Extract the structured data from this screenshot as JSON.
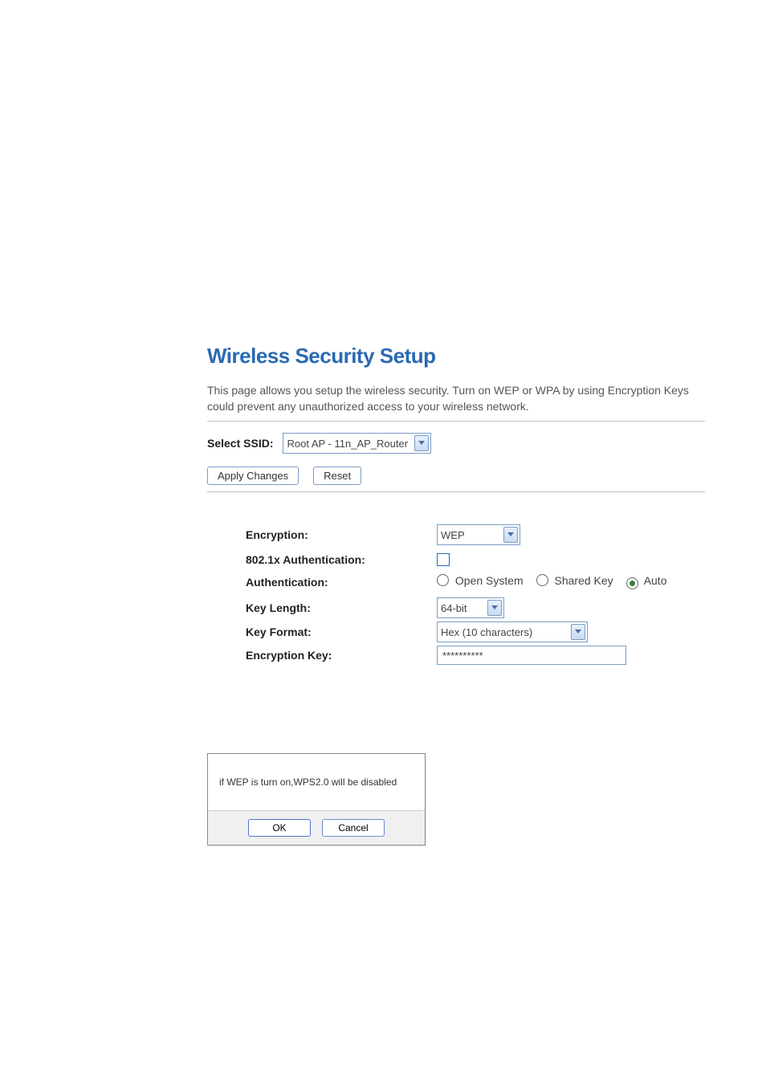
{
  "title": "Wireless Security Setup",
  "description": "This page allows you setup the wireless security. Turn on WEP or WPA by using Encryption Keys could prevent any unauthorized access to your wireless network.",
  "ssid": {
    "label": "Select SSID:",
    "value": "Root AP - 11n_AP_Router"
  },
  "buttons": {
    "apply": "Apply Changes",
    "reset": "Reset"
  },
  "form": {
    "encryption": {
      "label": "Encryption:",
      "value": "WEP"
    },
    "auth8021x": {
      "label": "802.1x Authentication:",
      "checked": false
    },
    "authentication": {
      "label": "Authentication:",
      "options": [
        "Open System",
        "Shared Key",
        "Auto"
      ],
      "selected": "Auto"
    },
    "key_length": {
      "label": "Key Length:",
      "value": "64-bit"
    },
    "key_format": {
      "label": "Key Format:",
      "value": "Hex (10 characters)"
    },
    "encryption_key": {
      "label": "Encryption Key:",
      "value": "**********"
    }
  },
  "dialog": {
    "message": "if WEP is turn on,WPS2.0 will be disabled",
    "ok": "OK",
    "cancel": "Cancel"
  }
}
